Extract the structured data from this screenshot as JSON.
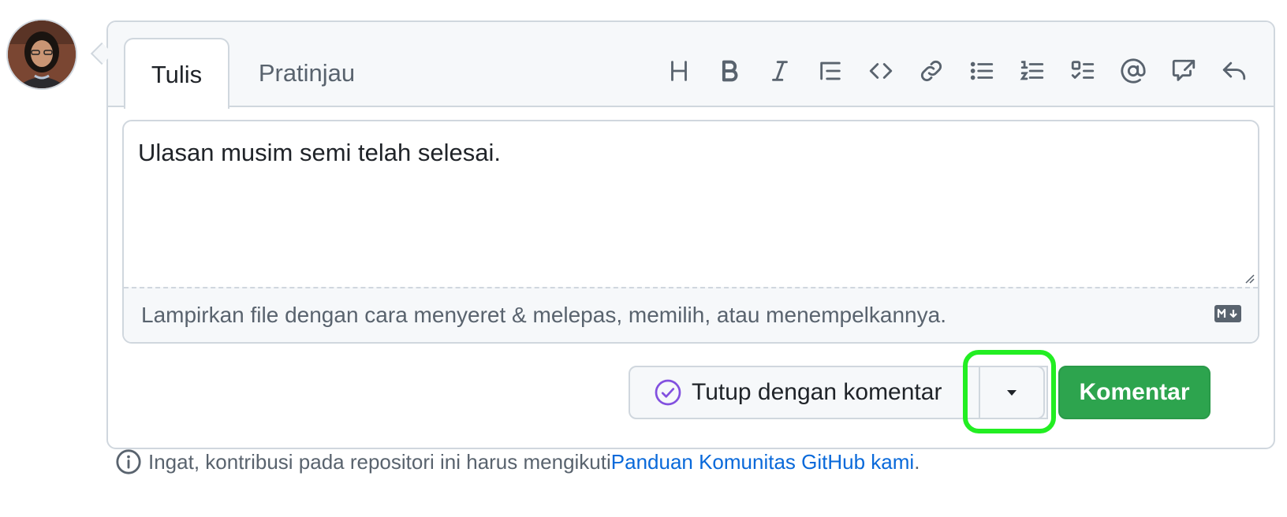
{
  "tabs": {
    "write": "Tulis",
    "preview": "Pratinjau"
  },
  "toolbar": {
    "tools": [
      {
        "name": "heading-icon"
      },
      {
        "name": "bold-icon"
      },
      {
        "name": "italic-icon"
      },
      {
        "name": "quote-icon"
      },
      {
        "name": "code-icon"
      },
      {
        "name": "link-icon"
      },
      {
        "name": "unordered-list-icon"
      },
      {
        "name": "ordered-list-icon"
      },
      {
        "name": "task-list-icon"
      },
      {
        "name": "mention-icon"
      },
      {
        "name": "cross-reference-icon"
      },
      {
        "name": "reply-icon"
      }
    ]
  },
  "editor": {
    "text": "Ulasan musim semi telah selesai.",
    "attach_hint": "Lampirkan file dengan cara menyeret & melepas, memilih, atau menempelkannya.",
    "markdown_icon": "markdown-icon"
  },
  "actions": {
    "close_label": "Tutup dengan komentar",
    "comment_label": "Komentar",
    "dropdown_icon": "triangle-down-icon",
    "close_icon": "check-circle-icon"
  },
  "colors": {
    "primary": "#2da44e",
    "highlight": "#22ee22",
    "link": "#0969da",
    "closed_purple": "#8250df"
  },
  "footer": {
    "text": "Ingat, kontribusi pada repositori ini harus mengikuti ",
    "link": "Panduan Komunitas GitHub kami",
    "end": "."
  }
}
